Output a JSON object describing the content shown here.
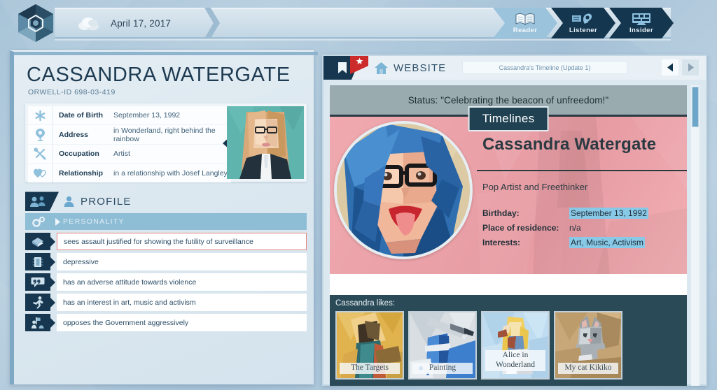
{
  "topbar": {
    "date": "April 17, 2017",
    "weather_icon": "cloud-icon",
    "logo_icon": "hexagon-logo-icon",
    "modes": [
      {
        "label": "Reader",
        "icon": "book-icon",
        "active": true
      },
      {
        "label": "Listener",
        "icon": "ear-icon",
        "active": false
      },
      {
        "label": "Insider",
        "icon": "monitor-icon",
        "active": false
      }
    ]
  },
  "left_panel": {
    "person_name": "CASSANDRA WATERGATE",
    "orwell_id_label": "ORWELL-ID",
    "orwell_id_value": "698-03-419",
    "info_rows": [
      {
        "icon": "asterisk-icon",
        "key": "Date of Birth",
        "value": "September 13, 1992"
      },
      {
        "icon": "location-pin-icon",
        "key": "Address",
        "value": "in Wonderland, right behind the rainbow"
      },
      {
        "icon": "tools-icon",
        "key": "Occupation",
        "value": "Artist"
      },
      {
        "icon": "hearts-icon",
        "key": "Relationship",
        "value": "in a relationship with Josef Langley"
      }
    ],
    "profile": {
      "tab_icon": "people-icon",
      "title_icon": "person-icon",
      "title": "PROFILE",
      "section": {
        "icon": "gears-icon",
        "arrow_icon": "chevron-right-icon",
        "label": "PERSONALITY"
      },
      "traits": [
        {
          "icon": "book-stack-icon",
          "text": "sees assault justified for showing the futility of surveillance",
          "flagged": true
        },
        {
          "icon": "chip-icon",
          "text": "depressive",
          "flagged": false
        },
        {
          "icon": "quote-icon",
          "text": "has an adverse attitude towards violence",
          "flagged": false
        },
        {
          "icon": "runner-icon",
          "text": "has an interest in art, music and activism",
          "flagged": false
        },
        {
          "icon": "protest-icon",
          "text": "opposes the Government aggressively",
          "flagged": false
        }
      ]
    }
  },
  "right_panel": {
    "header": {
      "bookmark_icon": "bookmark-icon",
      "flag_icon": "star-icon",
      "home_icon": "home-icon",
      "label": "WEBSITE",
      "url": "Cassandra's Timeline (Update 1)",
      "prev_icon": "arrow-left-icon",
      "next_icon": "arrow-right-icon"
    },
    "website": {
      "status": "Status: \"Celebrating the beacon of unfreedom!\"",
      "badge": "Timelines",
      "profile_name": "Cassandra Watergate",
      "tagline": "Pop Artist and Freethinker",
      "facts": [
        {
          "key": "Birthday:",
          "value": "September 13, 1992",
          "highlighted": true
        },
        {
          "key": "Place of residence:",
          "value": "n/a",
          "highlighted": false
        },
        {
          "key": "Interests:",
          "value": "Art, Music, Activism",
          "highlighted": true
        }
      ],
      "likes_title": "Cassandra likes:",
      "likes": [
        {
          "label": "The Targets"
        },
        {
          "label": "Painting"
        },
        {
          "label": "Alice in Wonderland"
        },
        {
          "label": "My cat Kikiko"
        }
      ]
    }
  },
  "colors": {
    "navy": "#16374f",
    "accent_blue": "#8ebdd6",
    "flag_red": "#cc2b2b",
    "highlight": "#89c9e8",
    "hero_pink": "#eba3a9",
    "likes_bg": "#2b4a58"
  }
}
